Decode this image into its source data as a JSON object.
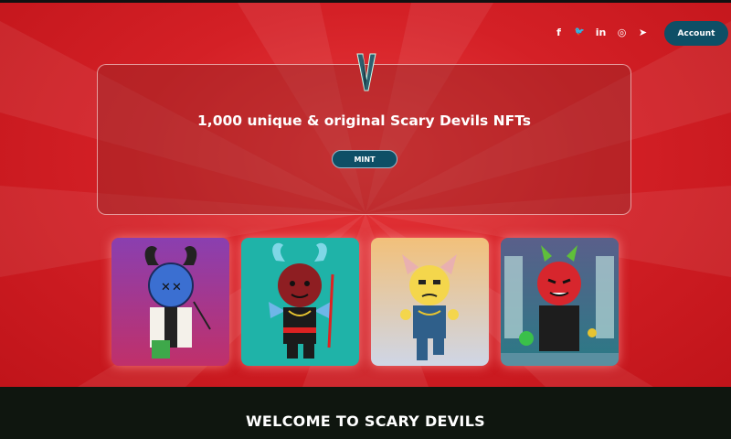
{
  "header": {
    "socials": [
      {
        "icon": "facebook-icon",
        "glyph": "f"
      },
      {
        "icon": "twitter-icon",
        "glyph": "🐦"
      },
      {
        "icon": "linkedin-icon",
        "glyph": "in"
      },
      {
        "icon": "instagram-icon",
        "glyph": "◎"
      },
      {
        "icon": "telegram-icon",
        "glyph": "➤"
      }
    ],
    "account_label": "Account"
  },
  "hero": {
    "title": "1,000 unique & original Scary Devils NFTs",
    "mint_label": "MINT"
  },
  "gallery": {
    "cards": [
      {
        "name": "devil-purple",
        "bg": "#8a3fb0"
      },
      {
        "name": "devil-teal",
        "bg": "#1fb3a8"
      },
      {
        "name": "devil-yellow",
        "bg": "#e9c98a"
      },
      {
        "name": "devil-lab",
        "bg": "#2e6e78"
      }
    ]
  },
  "footer": {
    "welcome": "WELCOME TO SCARY DEVILS"
  },
  "colors": {
    "accent": "#0e4f66",
    "background": "#d42026",
    "footer": "#0f160f"
  }
}
